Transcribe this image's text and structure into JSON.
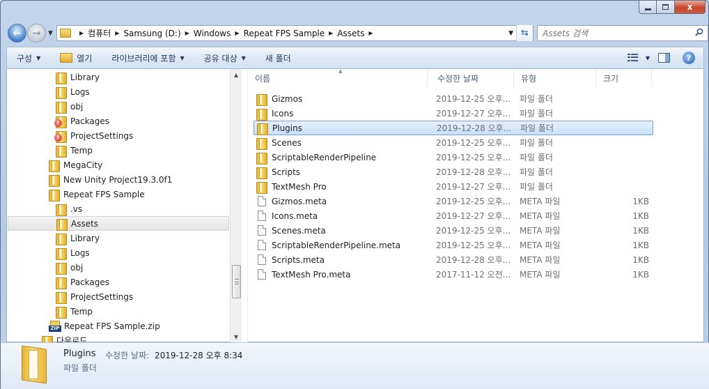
{
  "window": {
    "caption": {
      "min": "—",
      "max": "□",
      "close": "x"
    }
  },
  "address": {
    "breadcrumbs": [
      "컴퓨터",
      "Samsung (D:)",
      "Windows",
      "Repeat FPS Sample",
      "Assets"
    ],
    "search_placeholder": "Assets 검색"
  },
  "toolbar": {
    "organize": "구성",
    "open": "열기",
    "include_library": "라이브러리에 포함",
    "share": "공유 대상",
    "new_folder": "새 폴더"
  },
  "navpane": {
    "items": [
      {
        "label": "Library",
        "indent": 2,
        "icon": "folder",
        "selected": false
      },
      {
        "label": "Logs",
        "indent": 2,
        "icon": "folder",
        "selected": false
      },
      {
        "label": "obj",
        "indent": 2,
        "icon": "folder",
        "selected": false
      },
      {
        "label": "Packages",
        "indent": 2,
        "icon": "folder-warning",
        "selected": false
      },
      {
        "label": "ProjectSettings",
        "indent": 2,
        "icon": "folder-warning",
        "selected": false
      },
      {
        "label": "Temp",
        "indent": 2,
        "icon": "folder",
        "selected": false
      },
      {
        "label": "MegaCity",
        "indent": 1,
        "icon": "folder",
        "selected": false
      },
      {
        "label": "New Unity Project19.3.0f1",
        "indent": 1,
        "icon": "folder",
        "selected": false
      },
      {
        "label": "Repeat FPS Sample",
        "indent": 1,
        "icon": "folder",
        "selected": false
      },
      {
        "label": ".vs",
        "indent": 2,
        "icon": "folder",
        "selected": false
      },
      {
        "label": "Assets",
        "indent": 2,
        "icon": "folder",
        "selected": true
      },
      {
        "label": "Library",
        "indent": 2,
        "icon": "folder",
        "selected": false
      },
      {
        "label": "Logs",
        "indent": 2,
        "icon": "folder",
        "selected": false
      },
      {
        "label": "obj",
        "indent": 2,
        "icon": "folder",
        "selected": false
      },
      {
        "label": "Packages",
        "indent": 2,
        "icon": "folder",
        "selected": false
      },
      {
        "label": "ProjectSettings",
        "indent": 2,
        "icon": "folder",
        "selected": false
      },
      {
        "label": "Temp",
        "indent": 2,
        "icon": "folder",
        "selected": false
      },
      {
        "label": "Repeat FPS Sample.zip",
        "indent": 1,
        "icon": "zip",
        "selected": false
      },
      {
        "label": "다운로드",
        "indent": 0,
        "icon": "folder",
        "selected": false
      }
    ]
  },
  "filelist": {
    "columns": {
      "name": "이름",
      "date": "수정한 날짜",
      "type": "유형",
      "size": "크기"
    },
    "rows": [
      {
        "name": "Gizmos",
        "date": "2019-12-25 오후...",
        "type": "파일 폴더",
        "size": "",
        "icon": "folder",
        "selected": false
      },
      {
        "name": "Icons",
        "date": "2019-12-27 오후...",
        "type": "파일 폴더",
        "size": "",
        "icon": "folder",
        "selected": false
      },
      {
        "name": "Plugins",
        "date": "2019-12-28 오후...",
        "type": "파일 폴더",
        "size": "",
        "icon": "folder",
        "selected": true
      },
      {
        "name": "Scenes",
        "date": "2019-12-25 오후...",
        "type": "파일 폴더",
        "size": "",
        "icon": "folder",
        "selected": false
      },
      {
        "name": "ScriptableRenderPipeline",
        "date": "2019-12-25 오후...",
        "type": "파일 폴더",
        "size": "",
        "icon": "folder",
        "selected": false
      },
      {
        "name": "Scripts",
        "date": "2019-12-28 오후...",
        "type": "파일 폴더",
        "size": "",
        "icon": "folder",
        "selected": false
      },
      {
        "name": "TextMesh Pro",
        "date": "2019-12-27 오후...",
        "type": "파일 폴더",
        "size": "",
        "icon": "folder",
        "selected": false
      },
      {
        "name": "Gizmos.meta",
        "date": "2019-12-25 오후...",
        "type": "META 파일",
        "size": "1KB",
        "icon": "file",
        "selected": false
      },
      {
        "name": "Icons.meta",
        "date": "2019-12-27 오후...",
        "type": "META 파일",
        "size": "1KB",
        "icon": "file",
        "selected": false
      },
      {
        "name": "Scenes.meta",
        "date": "2019-12-25 오후...",
        "type": "META 파일",
        "size": "1KB",
        "icon": "file",
        "selected": false
      },
      {
        "name": "ScriptableRenderPipeline.meta",
        "date": "2019-12-25 오후...",
        "type": "META 파일",
        "size": "1KB",
        "icon": "file",
        "selected": false
      },
      {
        "name": "Scripts.meta",
        "date": "2019-12-28 오후...",
        "type": "META 파일",
        "size": "1KB",
        "icon": "file",
        "selected": false
      },
      {
        "name": "TextMesh Pro.meta",
        "date": "2017-11-12 오전...",
        "type": "META 파일",
        "size": "1KB",
        "icon": "file",
        "selected": false
      }
    ]
  },
  "details": {
    "name": "Plugins",
    "modified_label": "수정한 날짜:",
    "modified_value": "2019-12-28 오후 8:34",
    "type": "파일 폴더"
  }
}
